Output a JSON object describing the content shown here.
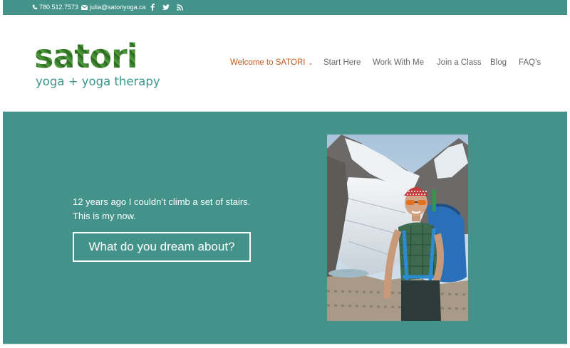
{
  "topbar": {
    "phone": "780.512.7573",
    "email": "julia@satoriyoga.ca",
    "icons": [
      "phone-icon",
      "mail-icon",
      "facebook-icon",
      "twitter-icon",
      "rss-icon"
    ]
  },
  "logo": {
    "word": "satori",
    "tagline": "yoga + yoga therapy"
  },
  "nav": {
    "items": [
      {
        "label": "Welcome to SATORI",
        "active": true,
        "has_dropdown": true
      },
      {
        "label": "Start Here"
      },
      {
        "label": "Work With Me"
      },
      {
        "label": "Join a Class"
      },
      {
        "label": "Blog"
      },
      {
        "label": "FAQ’s"
      }
    ]
  },
  "hero": {
    "line1": "12 years ago I couldn’t climb a set of stairs.",
    "line2": "This is my now.",
    "cta_label": "What do you dream about?"
  },
  "colors": {
    "teal": "#43938a",
    "nav_active": "#c65a1c",
    "nav_text": "#666666"
  }
}
